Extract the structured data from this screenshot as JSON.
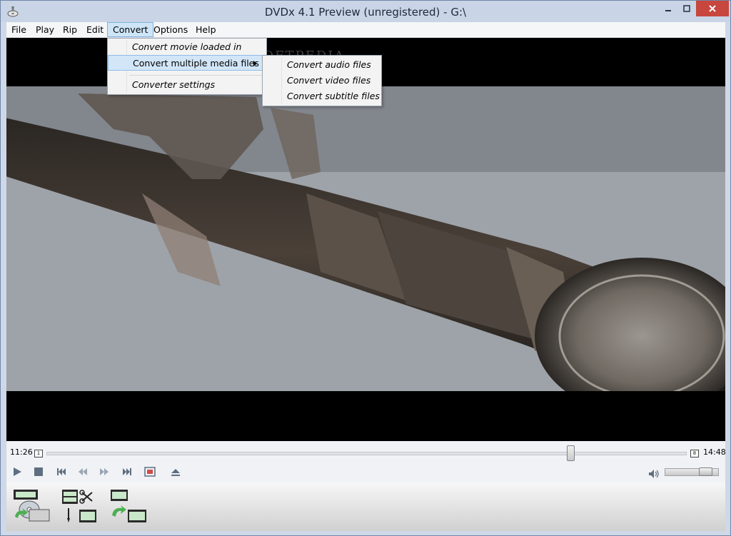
{
  "window": {
    "title": "DVDx 4.1 Preview (unregistered) - G:\\"
  },
  "menubar": {
    "items": [
      {
        "label": "File"
      },
      {
        "label": "Play"
      },
      {
        "label": "Rip"
      },
      {
        "label": "Edit"
      },
      {
        "label": "Convert"
      },
      {
        "label": "Options"
      },
      {
        "label": "Help"
      }
    ],
    "active": "Convert"
  },
  "convert_menu": {
    "items": [
      {
        "label": "Convert movie loaded in player"
      },
      {
        "label": "Convert multiple media files"
      },
      {
        "label": "Converter settings"
      }
    ]
  },
  "submenu": {
    "items": [
      {
        "label": "Convert audio files"
      },
      {
        "label": "Convert video files"
      },
      {
        "label": "Convert subtitle files"
      }
    ]
  },
  "watermark": "SOFTPEDIA",
  "player": {
    "current_time": "11:26",
    "start_marker": "1",
    "end_marker": "8",
    "total_time": "14:48",
    "progress_fraction": 0.82,
    "volume_fraction": 0.85
  },
  "icons": {
    "app": "dvd-disc-icon",
    "play": "play-icon",
    "stop": "stop-icon",
    "prev": "skip-back-icon",
    "rewind": "rewind-icon",
    "forward": "fast-forward-icon",
    "next": "skip-forward-icon",
    "fullscreen": "fullscreen-icon",
    "eject": "eject-icon",
    "volume": "speaker-icon"
  },
  "colors": {
    "titlebar": "#c9d5e6",
    "close": "#c7463e",
    "menu_highlight": "#cde5f7"
  }
}
